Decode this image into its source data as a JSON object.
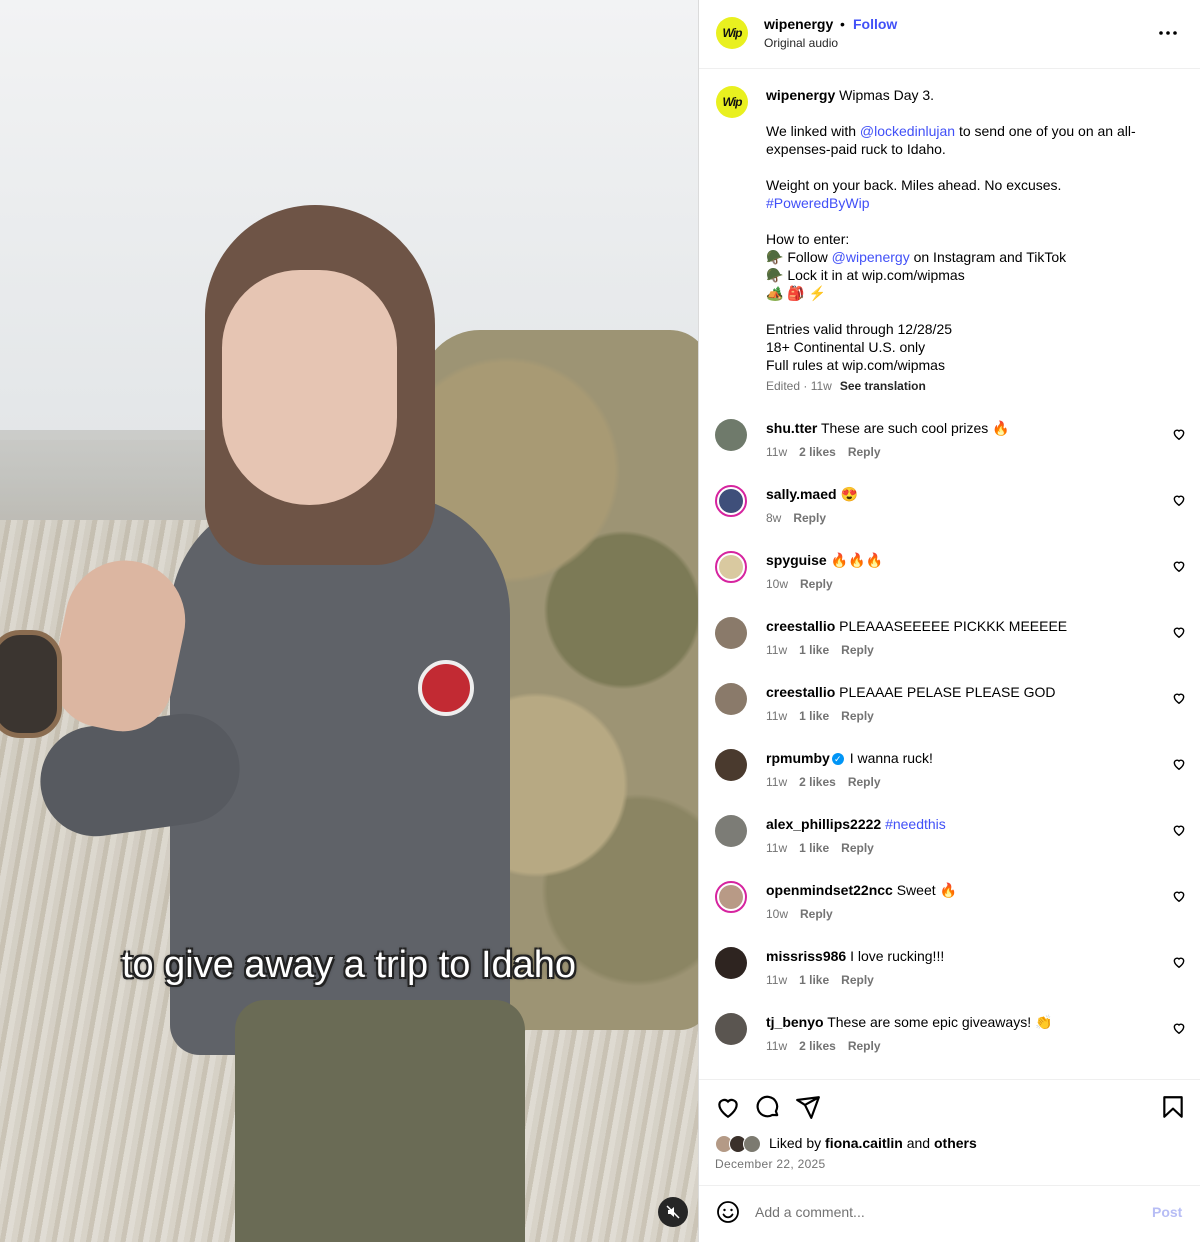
{
  "post": {
    "username": "wipenergy",
    "dot": "•",
    "follow": "Follow",
    "audio": "Original audio",
    "logo_text": "Wip",
    "video_caption": "to give away a trip to Idaho",
    "more_icon": "more-icon"
  },
  "caption": {
    "username": "wipenergy",
    "line1": " Wipmas Day 3.",
    "p2_a": "We linked with ",
    "p2_mention": "@lockedinlujan",
    "p2_b": " to send one of you on an all-expenses-paid ruck to Idaho.",
    "p3": "Weight on your back. Miles ahead. No excuses.",
    "p3_hashtag": "#PoweredByWip",
    "p4_title": "How to enter:",
    "p4_a": "🪖 Follow ",
    "p4_mention": "@wipenergy",
    "p4_b": " on Instagram and TikTok",
    "p4_c": "🪖 Lock it in at wip.com/wipmas",
    "p4_d": "🏕️ 🎒 ⚡",
    "p5_a": "Entries valid through 12/28/25",
    "p5_b": "18+ Continental U.S. only",
    "p5_c": "Full rules at wip.com/wipmas",
    "edited": "Edited · 11w",
    "see_translation": "See translation"
  },
  "comments": [
    {
      "user": "shu.tter",
      "text": "These are such cool prizes 🔥",
      "age": "11w",
      "likes": "2 likes",
      "reply": "Reply",
      "color": "#6f7a6b"
    },
    {
      "user": "sally.maed",
      "text": "😍",
      "age": "8w",
      "likes": "",
      "reply": "Reply",
      "color": "#3f4f7a"
    },
    {
      "user": "spyguise",
      "text": "🔥🔥🔥",
      "age": "10w",
      "likes": "",
      "reply": "Reply",
      "color": "#d9c9a0"
    },
    {
      "user": "creestallio",
      "text": "PLEAAASEEEEE PICKKK MEEEEE",
      "age": "11w",
      "likes": "1 like",
      "reply": "Reply",
      "color": "#8a7a6a"
    },
    {
      "user": "creestallio",
      "text": "PLEAAAE PELASE PLEASE GOD",
      "age": "11w",
      "likes": "1 like",
      "reply": "Reply",
      "color": "#8a7a6a"
    },
    {
      "user": "rpmumby",
      "text": "I wanna ruck!",
      "age": "11w",
      "likes": "2 likes",
      "reply": "Reply",
      "color": "#4a3a2e"
    },
    {
      "user": "alex_phillips2222",
      "text": "#needthis",
      "age": "11w",
      "likes": "1 like",
      "reply": "Reply",
      "color": "#7c7c76"
    },
    {
      "user": "openmindset22ncc",
      "text": "Sweet 🔥",
      "age": "10w",
      "likes": "",
      "reply": "Reply",
      "color": "#b89a86"
    },
    {
      "user": "missriss986",
      "text": "I love rucking!!!",
      "age": "11w",
      "likes": "1 like",
      "reply": "Reply",
      "color": "#2e2420"
    },
    {
      "user": "tj_benyo",
      "text": "These are some epic giveaways! 👏",
      "age": "11w",
      "likes": "2 likes",
      "reply": "Reply",
      "color": "#5a5550"
    }
  ],
  "footer": {
    "liked_prefix": "Liked by ",
    "liked_user": "fiona.caitlin",
    "liked_and": " and ",
    "liked_others": "others",
    "date": "December 22, 2025",
    "add_placeholder": "Add a comment...",
    "post": "Post"
  }
}
